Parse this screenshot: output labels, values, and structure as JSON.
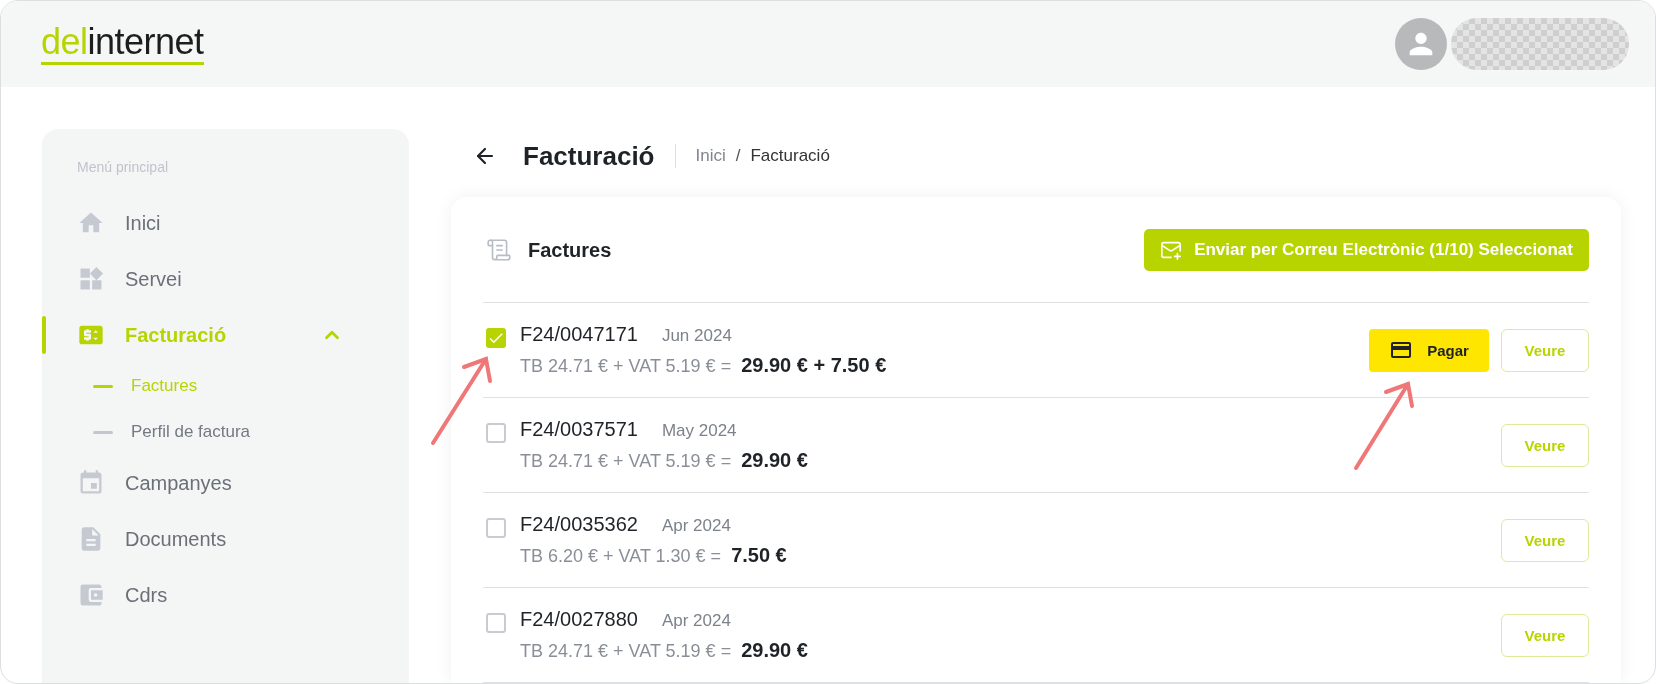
{
  "header": {
    "logo": {
      "accent": "del",
      "rest": "internet"
    }
  },
  "sidebar": {
    "heading": "Menú principal",
    "items": [
      {
        "label": "Inici",
        "selected": false
      },
      {
        "label": "Servei",
        "selected": false
      },
      {
        "label": "Facturació",
        "selected": true,
        "expanded": true,
        "children": [
          {
            "label": "Factures",
            "selected": true
          },
          {
            "label": "Perfil de factura",
            "selected": false
          }
        ]
      },
      {
        "label": "Campanyes",
        "selected": false
      },
      {
        "label": "Documents",
        "selected": false
      },
      {
        "label": "Cdrs",
        "selected": false
      }
    ]
  },
  "page": {
    "title": "Facturació",
    "breadcrumb": [
      "Inici",
      "Facturació"
    ],
    "breadcrumb_separator": "/"
  },
  "invoices": {
    "title": "Factures",
    "send_button": "Enviar per Correu Electrònic (1/10) Seleccionat",
    "rows": [
      {
        "number": "F24/0047171",
        "date": "Jun 2024",
        "breakdown": "TB 24.71 € + VAT 5.19 € =",
        "total": "29.90 € + 7.50 €",
        "checked": true,
        "pay_button": "Pagar",
        "view_button": "Veure"
      },
      {
        "number": "F24/0037571",
        "date": "May 2024",
        "breakdown": "TB 24.71 € + VAT 5.19 € =",
        "total": "29.90 €",
        "checked": false,
        "view_button": "Veure"
      },
      {
        "number": "F24/0035362",
        "date": "Apr 2024",
        "breakdown": "TB 6.20 € + VAT 1.30 € =",
        "total": "7.50 €",
        "checked": false,
        "view_button": "Veure"
      },
      {
        "number": "F24/0027880",
        "date": "Apr 2024",
        "breakdown": "TB 24.71 € + VAT 5.19 € =",
        "total": "29.90 €",
        "checked": false,
        "view_button": "Veure"
      }
    ]
  }
}
